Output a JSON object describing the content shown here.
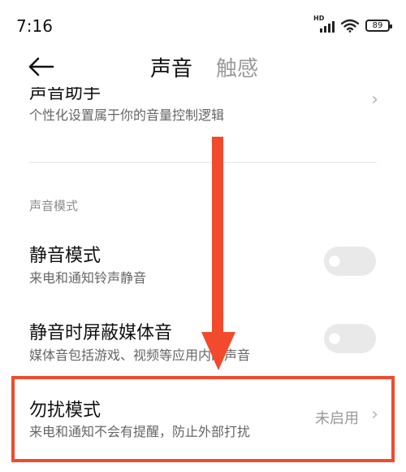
{
  "status_bar": {
    "time": "7:16",
    "network_badge": "HD",
    "battery": "89",
    "icons": [
      "signal-icon",
      "wifi-icon",
      "battery-icon"
    ]
  },
  "header": {
    "tab_active": "声音",
    "tab_inactive": "触感",
    "icons": [
      "back-arrow-icon"
    ]
  },
  "rows": {
    "partial_title": "声音助手",
    "partial_subtitle": "个性化设置属于你的音量控制逻辑",
    "section_label": "声音模式",
    "mute": {
      "title": "静音模式",
      "subtitle": "来电和通知铃声静音",
      "enabled": false
    },
    "mute_media": {
      "title": "静音时屏蔽媒体音",
      "subtitle": "媒体音包括游戏、视频等应用内的声音",
      "enabled": false
    },
    "dnd": {
      "title": "勿扰模式",
      "subtitle": "来电和通知不会有提醒，防止外部打扰",
      "value": "未启用"
    }
  },
  "colors": {
    "annotation": "#f24a2d",
    "toggle_off": "#e9e9e9",
    "secondary_text": "#666666",
    "value_text": "#999999"
  }
}
